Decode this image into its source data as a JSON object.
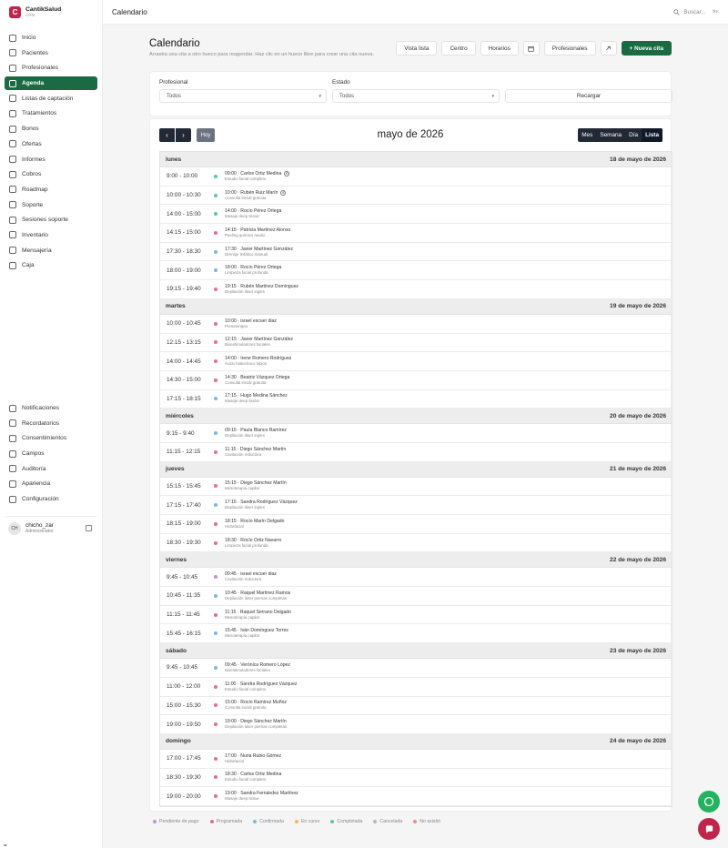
{
  "brand": {
    "name": "CantikSalud",
    "sub": "CRM",
    "logo": "C"
  },
  "nav_main": [
    {
      "label": "Inicio",
      "icon": "home-icon"
    },
    {
      "label": "Pacientes",
      "icon": "users-icon"
    },
    {
      "label": "Profesionales",
      "icon": "user-icon"
    },
    {
      "label": "Agenda",
      "icon": "calendar-icon",
      "active": true
    },
    {
      "label": "Listas de captación",
      "icon": "list-icon"
    },
    {
      "label": "Tratamientos",
      "icon": "sparkle-icon"
    },
    {
      "label": "Bonos",
      "icon": "ticket-icon"
    },
    {
      "label": "Ofertas",
      "icon": "tag-icon"
    },
    {
      "label": "Informes",
      "icon": "chart-icon"
    },
    {
      "label": "Cobros",
      "icon": "money-icon"
    },
    {
      "label": "Roadmap",
      "icon": "map-icon"
    },
    {
      "label": "Soporte",
      "icon": "help-icon"
    },
    {
      "label": "Sesiones soporte",
      "icon": "chat-icon"
    },
    {
      "label": "Inventario",
      "icon": "box-icon"
    },
    {
      "label": "Mensajería",
      "icon": "message-icon"
    },
    {
      "label": "Caja",
      "icon": "cash-icon"
    }
  ],
  "nav_bottom": [
    {
      "label": "Notificaciones",
      "icon": "bell-icon"
    },
    {
      "label": "Recordatorios",
      "icon": "clock-icon"
    },
    {
      "label": "Consentimientos",
      "icon": "document-icon"
    },
    {
      "label": "Campos",
      "icon": "fields-icon"
    },
    {
      "label": "Auditoría",
      "icon": "shield-icon"
    },
    {
      "label": "Apariencia",
      "icon": "palette-icon"
    },
    {
      "label": "Configuración",
      "icon": "gear-icon"
    }
  ],
  "user": {
    "initials": "CH",
    "name": "chicho_zar",
    "role": "Administrador"
  },
  "topbar": {
    "title": "Calendario",
    "search_placeholder": "Buscar...",
    "shortcut": "⌘K"
  },
  "page": {
    "title": "Calendario",
    "subtitle": "Arrastra una cita a otro hueco para reagendar. Haz clic en un hueco libre para crear una cita nueva.",
    "actions": [
      "Vista lista",
      "Centro",
      "Horarios",
      "Profesionales"
    ],
    "new_button": "+ Nueva cita"
  },
  "filters": {
    "professional_label": "Profesional",
    "professional_value": "Todos",
    "status_label": "Estado",
    "status_value": "Todos",
    "reload": "Recargar"
  },
  "calendar": {
    "title": "mayo de 2026",
    "today": "Hoy",
    "views": [
      "Mes",
      "Semana",
      "Día",
      "Lista"
    ],
    "active_view": "Lista",
    "days": [
      {
        "name": "lunes",
        "date": "18 de mayo de 2026",
        "events": [
          {
            "range": "9:00 - 10:00",
            "title": "09:00 · Carlos Ortiz Medina",
            "sub": "Estudio facial completo",
            "color": "#5ac8a8",
            "badge": "€"
          },
          {
            "range": "10:00 - 10:30",
            "title": "10:00 · Rubén Ruiz Marín",
            "sub": "Consulta inicial gratuita",
            "color": "#5ac8a8",
            "badge": "€"
          },
          {
            "range": "14:00 - 15:00",
            "title": "14:00 · Rocío Pérez Ortega",
            "sub": "Masaje deep tissue",
            "color": "#5ac8a8"
          },
          {
            "range": "14:15 - 15:00",
            "title": "14:15 · Patricia Martínez Alonso",
            "sub": "Peeling químico medio",
            "color": "#e66b9a"
          },
          {
            "range": "17:30 - 18:30",
            "title": "17:30 · Javier Martínez González",
            "sub": "Drenaje linfático manual",
            "color": "#7fb6e0"
          },
          {
            "range": "18:00 - 19:00",
            "title": "18:00 · Rocío Pérez Ortega",
            "sub": "Limpieza facial profunda",
            "color": "#7fb6e0"
          },
          {
            "range": "19:15 - 19:40",
            "title": "19:15 · Rubén Martínez Domínguez",
            "sub": "Depilación láser ingles",
            "color": "#e66b9a"
          }
        ]
      },
      {
        "name": "martes",
        "date": "19 de mayo de 2026",
        "events": [
          {
            "range": "10:00 - 10:45",
            "title": "10:00 · israel escuer diaz",
            "sub": "Presoterapia",
            "color": "#e66b9a"
          },
          {
            "range": "12:15 - 13:15",
            "title": "12:15 · Javier Martínez González",
            "sub": "Bioestimuladores faciales",
            "color": "#e66b9a"
          },
          {
            "range": "14:00 - 14:45",
            "title": "14:00 · Irene Romero Rodríguez",
            "sub": "Ácido hialurónico labios",
            "color": "#e66b9a"
          },
          {
            "range": "14:30 - 15:00",
            "title": "14:30 · Beatriz Vázquez Ortega",
            "sub": "Consulta inicial gratuita",
            "color": "#e66b9a"
          },
          {
            "range": "17:15 - 18:15",
            "title": "17:15 · Hugo Medina Sánchez",
            "sub": "Masaje deep tissue",
            "color": "#7fb6e0"
          }
        ]
      },
      {
        "name": "miércoles",
        "date": "20 de mayo de 2026",
        "events": [
          {
            "range": "9:15 - 9:40",
            "title": "09:15 · Paula Blanco Ramírez",
            "sub": "Depilación láser ingles",
            "color": "#7fb6e0"
          },
          {
            "range": "11:15 - 12:15",
            "title": "11:15 · Diego Sánchez Martín",
            "sub": "Cavitación reductora",
            "color": "#e66b9a"
          }
        ]
      },
      {
        "name": "jueves",
        "date": "21 de mayo de 2026",
        "events": [
          {
            "range": "15:15 - 15:45",
            "title": "15:15 · Diego Sánchez Martín",
            "sub": "Mesoterapia capilar",
            "color": "#e66b9a"
          },
          {
            "range": "17:15 - 17:40",
            "title": "17:15 · Sandra Rodríguez Vázquez",
            "sub": "Depilación láser ingles",
            "color": "#7fb6e0"
          },
          {
            "range": "18:15 - 19:00",
            "title": "18:15 · Rocío Marín Delgado",
            "sub": "Hidrafacial",
            "color": "#e66b9a"
          },
          {
            "range": "18:30 - 19:30",
            "title": "18:30 · Rocío Ortiz Navarro",
            "sub": "Limpieza facial profunda",
            "color": "#e66b9a"
          }
        ]
      },
      {
        "name": "viernes",
        "date": "22 de mayo de 2026",
        "events": [
          {
            "range": "9:45 - 10:45",
            "title": "09:45 · israel escuer diaz",
            "sub": "Cavitación reductora",
            "color": "#b994e0"
          },
          {
            "range": "10:45 - 11:35",
            "title": "10:45 · Raquel Martínez Ramos",
            "sub": "Depilación láser piernas completas",
            "color": "#7fb6e0"
          },
          {
            "range": "11:15 - 11:45",
            "title": "11:15 · Raquel Serrano Delgado",
            "sub": "Mesoterapia capilar",
            "color": "#e66b9a"
          },
          {
            "range": "15:45 - 16:15",
            "title": "15:45 · Iván Domínguez Torres",
            "sub": "Mesoterapia capilar",
            "color": "#7fb6e0"
          }
        ]
      },
      {
        "name": "sábado",
        "date": "23 de mayo de 2026",
        "events": [
          {
            "range": "9:45 - 10:45",
            "title": "09:45 · Verónica Romero López",
            "sub": "Bioestimuladores faciales",
            "color": "#7fb6e0"
          },
          {
            "range": "11:00 - 12:00",
            "title": "11:00 · Sandra Rodríguez Vázquez",
            "sub": "Estudio facial completo",
            "color": "#e66b9a"
          },
          {
            "range": "15:00 - 15:30",
            "title": "15:00 · Rocío Ramírez Muñoz",
            "sub": "Consulta inicial gratuita",
            "color": "#e66b9a"
          },
          {
            "range": "19:00 - 19:50",
            "title": "19:00 · Diego Sánchez Martín",
            "sub": "Depilación láser piernas completas",
            "color": "#e66b9a"
          }
        ]
      },
      {
        "name": "domingo",
        "date": "24 de mayo de 2026",
        "events": [
          {
            "range": "17:00 - 17:45",
            "title": "17:00 · Nuria Rubio Gómez",
            "sub": "Hidrafacial",
            "color": "#e66b9a"
          },
          {
            "range": "18:30 - 19:30",
            "title": "18:30 · Carlos Ortiz Medina",
            "sub": "Estudio facial completo",
            "color": "#e66b9a"
          },
          {
            "range": "19:00 - 20:00",
            "title": "19:00 · Sandra Fernández Martínez",
            "sub": "Masaje deep tissue",
            "color": "#e66b9a"
          }
        ]
      }
    ]
  },
  "legend": [
    {
      "label": "Pendiente de pago",
      "color": "#b994e0"
    },
    {
      "label": "Programada",
      "color": "#e66b9a"
    },
    {
      "label": "Confirmada",
      "color": "#7fb6e0"
    },
    {
      "label": "En curso",
      "color": "#f4b860"
    },
    {
      "label": "Completada",
      "color": "#5ac8a8"
    },
    {
      "label": "Cancelada",
      "color": "#a9b8c8"
    },
    {
      "label": "No asistió",
      "color": "#f08a8a"
    }
  ],
  "colors": {
    "accent": "#1a6b44",
    "whatsapp": "#22b35e",
    "chat": "#c0264b"
  }
}
